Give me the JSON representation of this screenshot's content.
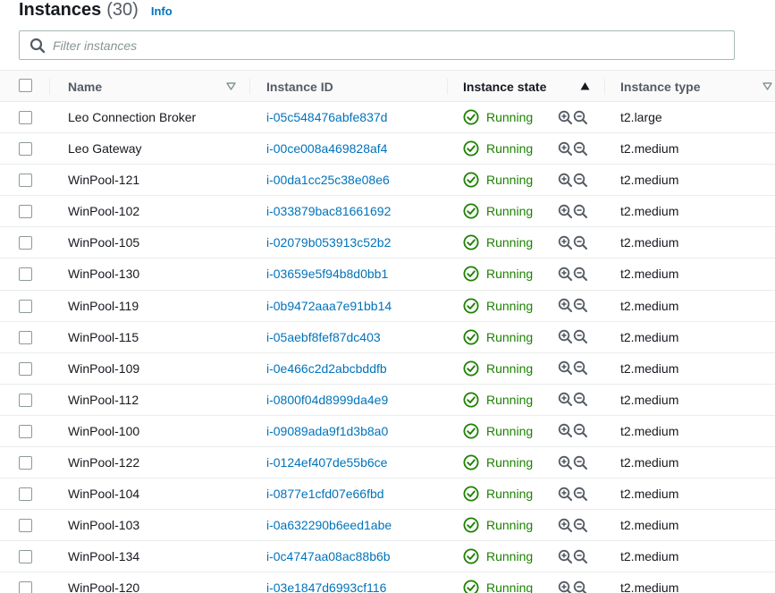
{
  "header": {
    "title": "Instances",
    "count": "(30)",
    "info": "Info"
  },
  "filter": {
    "placeholder": "Filter instances",
    "value": ""
  },
  "columns": {
    "name": "Name",
    "instance_id": "Instance ID",
    "instance_state": "Instance state",
    "instance_type": "Instance type"
  },
  "colors": {
    "link": "#0073bb",
    "running": "#1d8102",
    "text": "#16191f",
    "header_bg": "#fafafa"
  },
  "icons": {
    "search": "search-icon",
    "sort_desc": "caret-down-outline-icon",
    "sort_asc": "caret-up-filled-icon",
    "status": "check-circle-icon",
    "zoom_in": "zoom-in-icon",
    "zoom_out": "zoom-out-icon"
  },
  "rows": [
    {
      "name": "Leo Connection Broker",
      "id": "i-05c548476abfe837d",
      "state": "Running",
      "type": "t2.large"
    },
    {
      "name": "Leo Gateway",
      "id": "i-00ce008a469828af4",
      "state": "Running",
      "type": "t2.medium"
    },
    {
      "name": "WinPool-121",
      "id": "i-00da1cc25c38e08e6",
      "state": "Running",
      "type": "t2.medium"
    },
    {
      "name": "WinPool-102",
      "id": "i-033879bac81661692",
      "state": "Running",
      "type": "t2.medium"
    },
    {
      "name": "WinPool-105",
      "id": "i-02079b053913c52b2",
      "state": "Running",
      "type": "t2.medium"
    },
    {
      "name": "WinPool-130",
      "id": "i-03659e5f94b8d0bb1",
      "state": "Running",
      "type": "t2.medium"
    },
    {
      "name": "WinPool-119",
      "id": "i-0b9472aaa7e91bb14",
      "state": "Running",
      "type": "t2.medium"
    },
    {
      "name": "WinPool-115",
      "id": "i-05aebf8fef87dc403",
      "state": "Running",
      "type": "t2.medium"
    },
    {
      "name": "WinPool-109",
      "id": "i-0e466c2d2abcbddfb",
      "state": "Running",
      "type": "t2.medium"
    },
    {
      "name": "WinPool-112",
      "id": "i-0800f04d8999da4e9",
      "state": "Running",
      "type": "t2.medium"
    },
    {
      "name": "WinPool-100",
      "id": "i-09089ada9f1d3b8a0",
      "state": "Running",
      "type": "t2.medium"
    },
    {
      "name": "WinPool-122",
      "id": "i-0124ef407de55b6ce",
      "state": "Running",
      "type": "t2.medium"
    },
    {
      "name": "WinPool-104",
      "id": "i-0877e1cfd07e66fbd",
      "state": "Running",
      "type": "t2.medium"
    },
    {
      "name": "WinPool-103",
      "id": "i-0a632290b6eed1abe",
      "state": "Running",
      "type": "t2.medium"
    },
    {
      "name": "WinPool-134",
      "id": "i-0c4747aa08ac88b6b",
      "state": "Running",
      "type": "t2.medium"
    },
    {
      "name": "WinPool-120",
      "id": "i-03e1847d6993cf116",
      "state": "Running",
      "type": "t2.medium"
    }
  ]
}
